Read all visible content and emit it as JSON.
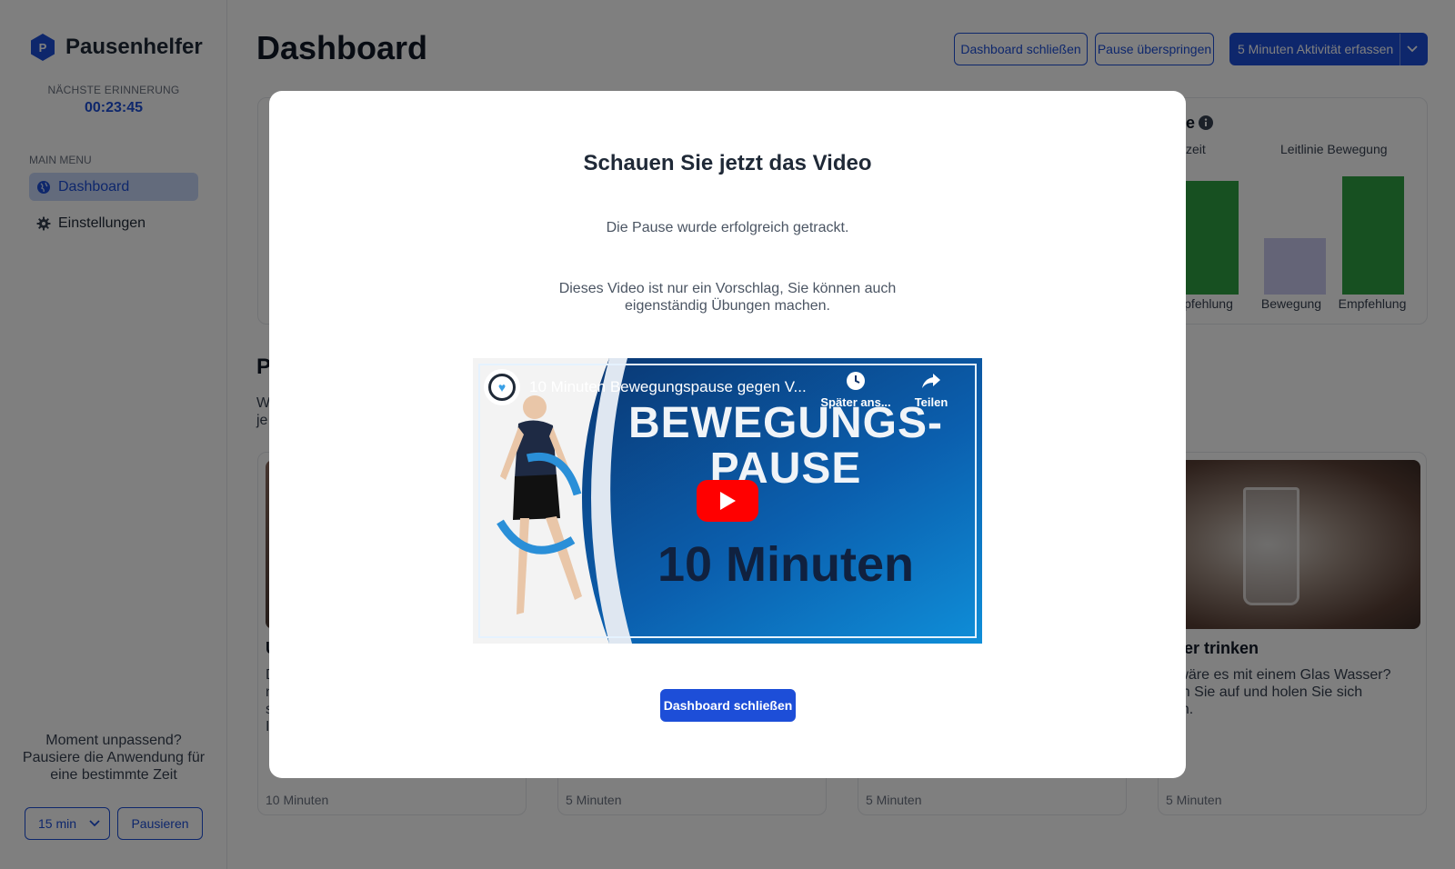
{
  "app": {
    "name": "Pausenhelfer",
    "next_reminder_label": "NÄCHSTE ERINNERUNG",
    "next_reminder_time": "00:23:45"
  },
  "sidebar": {
    "menu_label": "MAIN MENU",
    "items": [
      {
        "label": "Dashboard",
        "icon": "globe-icon",
        "active": true
      },
      {
        "label": "Einstellungen",
        "icon": "gear-icon",
        "active": false
      }
    ],
    "pause_prompt": "Moment unpassend? Pausiere die Anwendung für eine bestimmte Zeit",
    "pause_duration": "15 min",
    "pause_button": "Pausieren"
  },
  "header": {
    "title": "Dashboard",
    "close_button": "Dashboard schließen",
    "skip_button": "Pause überspringen",
    "log_button": "5 Minuten Aktivität erfassen"
  },
  "chart": {
    "title_fragment": "e",
    "head_left": "zeit",
    "head_right": "Leitlinie Bewegung",
    "labels": [
      "pfehlung",
      "Bewegung",
      "Empfehlung"
    ],
    "colors": {
      "recommendation": "#2ea043",
      "movement": "#c9c8ee"
    }
  },
  "chart_data": {
    "type": "bar",
    "categories": [
      "pfehlung",
      "Bewegung",
      "Empfehlung"
    ],
    "values": [
      125,
      62,
      130
    ],
    "title": "",
    "xlabel": "",
    "ylabel": ""
  },
  "section": {
    "title_fragment": "P",
    "sub_line1": "W",
    "sub_line2": "je"
  },
  "cards": [
    {
      "title": "U",
      "desc": "D\nn\ns\nI",
      "duration": "10 Minuten"
    },
    {
      "title": "",
      "desc": "",
      "duration": "5 Minuten"
    },
    {
      "title": "",
      "desc": "",
      "duration": "5 Minuten"
    },
    {
      "title": "sser trinken",
      "desc": "e wäre es mit einem Glas Wasser?\nhen Sie auf und holen Sie sich\nken.",
      "duration": "5 Minuten"
    }
  ],
  "modal": {
    "title": "Schauen Sie jetzt das Video",
    "success": "Die Pause wurde erfolgreich getrackt.",
    "note": "Dieses Video ist nur ein Vorschlag, Sie können auch eigenständig Übungen machen.",
    "close_button": "Dashboard schließen"
  },
  "video": {
    "title": "10 Minuten Bewegungspause gegen V...",
    "watch_later": "Später ans...",
    "share": "Teilen",
    "headline1": "BEWEGUNGS-",
    "headline2": "PAUSE",
    "duration_text": "10 Minuten"
  }
}
